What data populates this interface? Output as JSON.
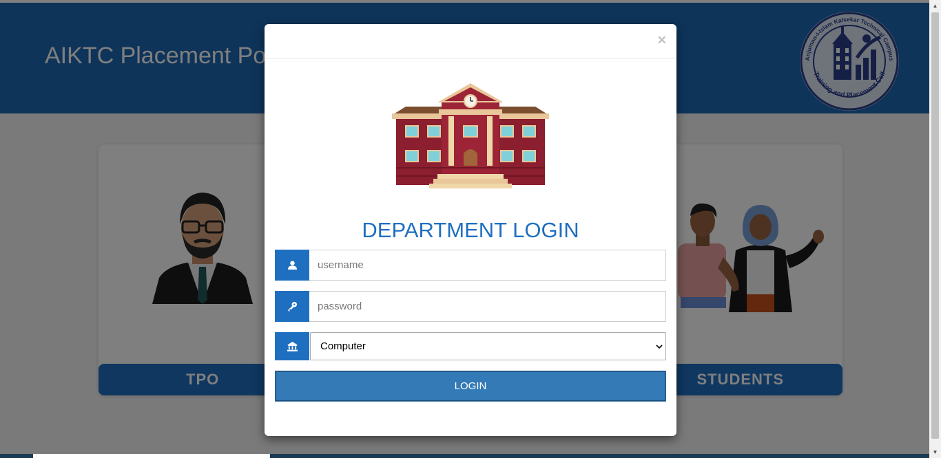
{
  "header": {
    "title": "AIKTC Placement Portal"
  },
  "logo": {
    "top_text": "Anjuman-I-Islam Kalsekar Technical Campus",
    "bottom_text": "Training and Placement Cell"
  },
  "cards": {
    "tpo_label": "TPO",
    "students_label": "STUDENTS"
  },
  "modal": {
    "close": "×",
    "title": "DEPARTMENT LOGIN",
    "username_placeholder": "username",
    "password_placeholder": "password",
    "department_selected": "Computer",
    "login_label": "LOGIN"
  },
  "colors": {
    "primary": "#1f6fc0",
    "header": "#1d69b4",
    "button": "#337ab7"
  },
  "icons": [
    "user-icon",
    "key-icon",
    "bank-icon",
    "close-icon",
    "chevron-down-icon"
  ]
}
